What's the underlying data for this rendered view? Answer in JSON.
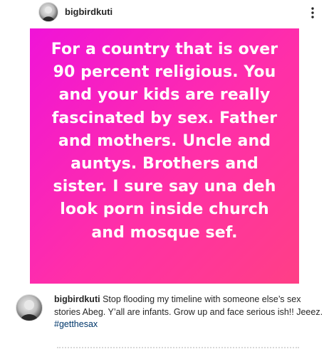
{
  "header": {
    "username": "bigbirdkuti",
    "avatar_icon": "profile-photo-icon",
    "more_icon": "more-vertical-icon"
  },
  "post": {
    "background_start": "#f013d8",
    "background_end": "#ff3f86",
    "text_color": "#ffffff",
    "text_lines": [
      "For a country that is over",
      "90 percent religious. You",
      "and your kids are really",
      "fascinated by sex. Father",
      "and mothers. Uncle and",
      "auntys. Brothers and",
      "sister. I sure say una deh",
      "look porn inside church",
      "and mosque sef."
    ]
  },
  "caption": {
    "username": "bigbirdkuti",
    "text": "Stop flooding my timeline with someone else’s sex stories Abeg. Y’all are infants. Grow up and face serious ish!! Jeeez.",
    "hashtag": "#getthesax",
    "hashtag_color": "#00376b"
  }
}
